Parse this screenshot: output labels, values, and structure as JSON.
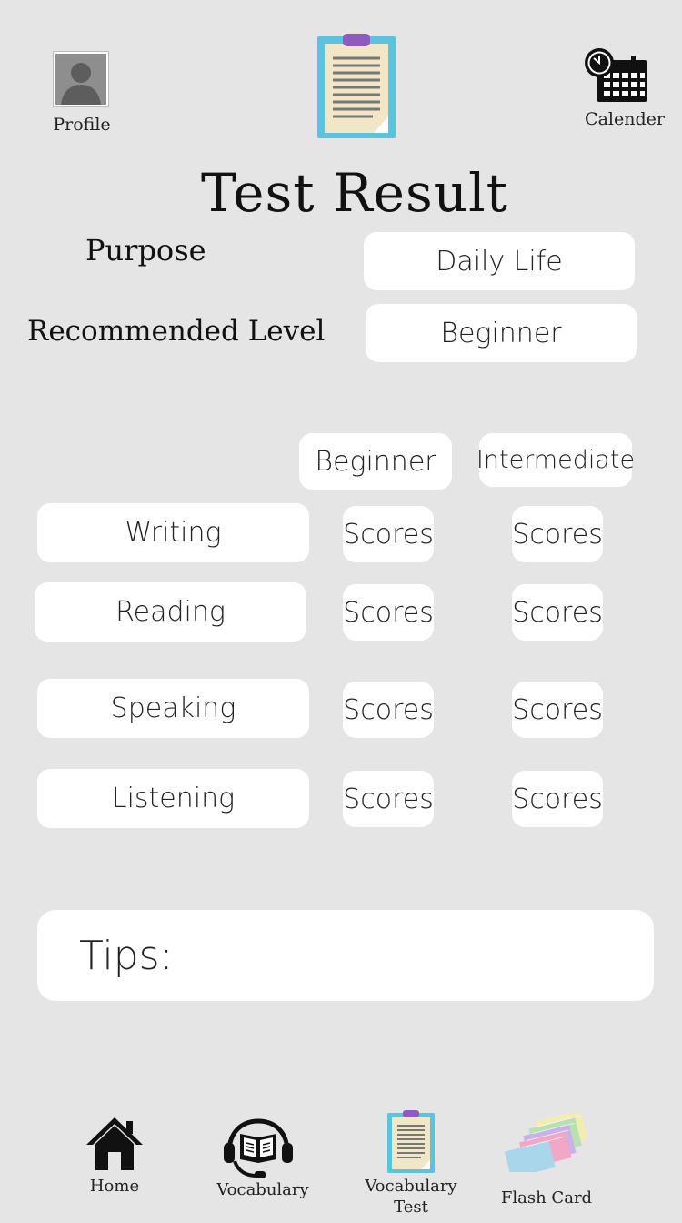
{
  "header": {
    "profile_label": "Profile",
    "calendar_label": "Calender",
    "title": "Test Result"
  },
  "summary": {
    "purpose_label": "Purpose",
    "purpose_value": "Daily Life",
    "level_label": "Recommended Level",
    "level_value": "Beginner"
  },
  "scores": {
    "columns": [
      "Beginner",
      "Intermediate"
    ],
    "rows": [
      {
        "skill": "Writing",
        "beginner": "Scores",
        "intermediate": "Scores"
      },
      {
        "skill": "Reading",
        "beginner": "Scores",
        "intermediate": "Scores"
      },
      {
        "skill": "Speaking",
        "beginner": "Scores",
        "intermediate": "Scores"
      },
      {
        "skill": "Listening",
        "beginner": "Scores",
        "intermediate": "Scores"
      }
    ]
  },
  "tips": {
    "label": "Tips:"
  },
  "bottom_nav": {
    "items": [
      {
        "label": "Home",
        "icon": "home-icon"
      },
      {
        "label": "Vocabulary",
        "icon": "audiobook-headset-icon"
      },
      {
        "label": "Vocabulary Test",
        "label_line1": "Vocabulary",
        "label_line2": "Test",
        "icon": "clipboard-icon"
      },
      {
        "label": "Flash Card",
        "icon": "flash-cards-icon"
      }
    ]
  },
  "colors": {
    "background": "#e5e5e5",
    "card": "#ffffff",
    "clipboard_frame": "#5bc3de",
    "clipboard_paper": "#f1e6c6",
    "clipboard_clip": "#8f5bbf"
  }
}
